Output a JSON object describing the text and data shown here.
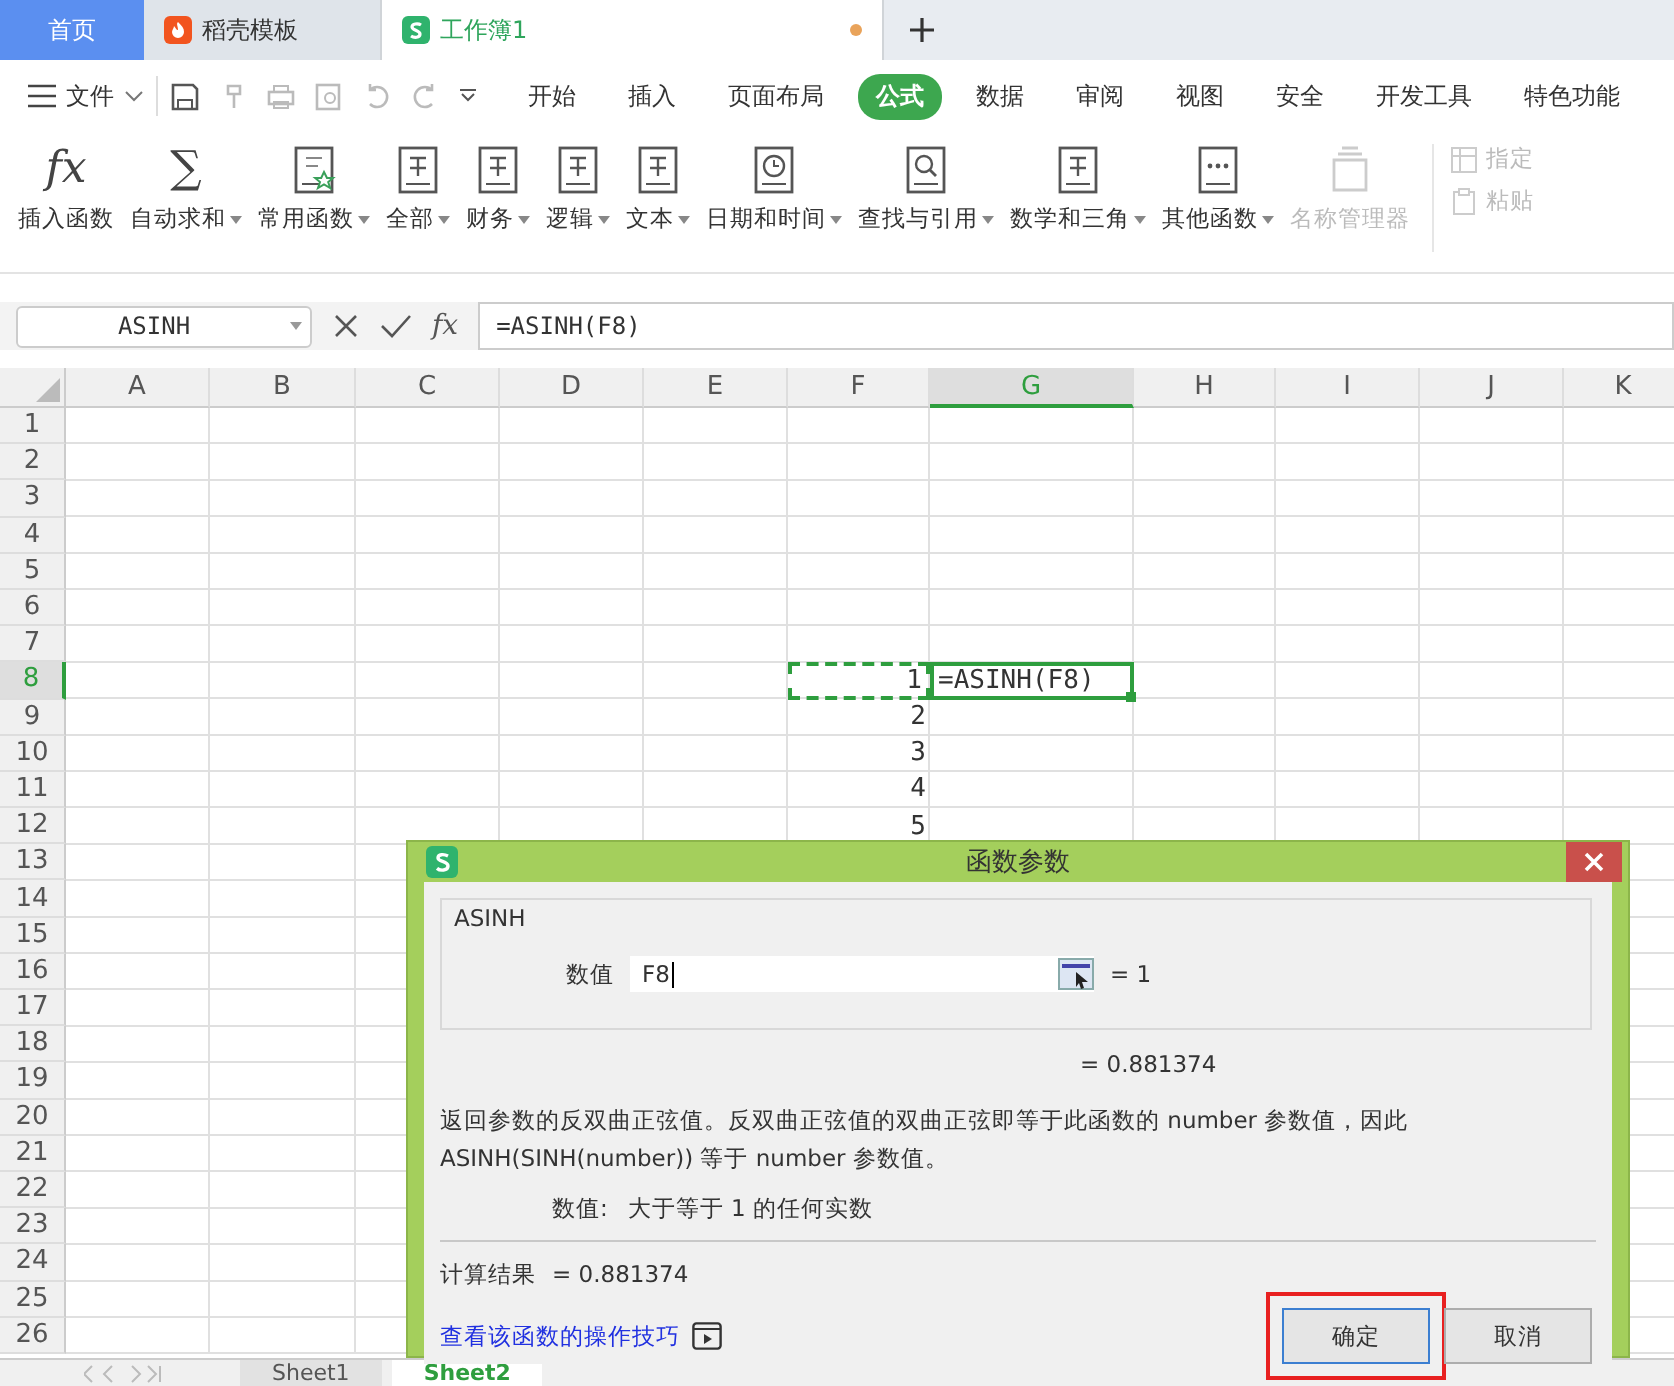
{
  "app_tabs": [
    {
      "label": "首页",
      "kind": "home",
      "selected": false
    },
    {
      "label": "稻壳模板",
      "kind": "docer",
      "selected": false
    },
    {
      "label": "工作簿1",
      "kind": "sheet",
      "selected": true,
      "unsaved": true
    }
  ],
  "menu": {
    "file": "文件",
    "tabs": [
      {
        "label": "开始",
        "selected": false
      },
      {
        "label": "插入",
        "selected": false
      },
      {
        "label": "页面布局",
        "selected": false
      },
      {
        "label": "公式",
        "selected": true
      },
      {
        "label": "数据",
        "selected": false
      },
      {
        "label": "审阅",
        "selected": false
      },
      {
        "label": "视图",
        "selected": false
      },
      {
        "label": "安全",
        "selected": false
      },
      {
        "label": "开发工具",
        "selected": false
      },
      {
        "label": "特色功能",
        "selected": false
      }
    ]
  },
  "ribbon": [
    {
      "label": "插入函数",
      "glyph": "fx",
      "kind": "glyph",
      "dropdown": false,
      "disabled": false
    },
    {
      "label": "自动求和",
      "glyph": "∑",
      "kind": "glyph",
      "dropdown": true,
      "disabled": false
    },
    {
      "label": "常用函数",
      "kind": "star-doc",
      "dropdown": true,
      "disabled": false
    },
    {
      "label": "全部",
      "kind": "lines-doc",
      "dropdown": true,
      "disabled": false
    },
    {
      "label": "财务",
      "kind": "lines-doc",
      "dropdown": true,
      "disabled": false
    },
    {
      "label": "逻辑",
      "kind": "lines-doc",
      "dropdown": true,
      "disabled": false
    },
    {
      "label": "文本",
      "kind": "lines-doc",
      "dropdown": true,
      "disabled": false
    },
    {
      "label": "日期和时间",
      "kind": "clock-doc",
      "dropdown": true,
      "disabled": false
    },
    {
      "label": "查找与引用",
      "kind": "search-doc",
      "dropdown": true,
      "disabled": false
    },
    {
      "label": "数学和三角",
      "kind": "lines-doc",
      "dropdown": true,
      "disabled": false
    },
    {
      "label": "其他函数",
      "kind": "dots-doc",
      "dropdown": true,
      "disabled": false
    },
    {
      "label": "名称管理器",
      "kind": "stack-doc",
      "dropdown": false,
      "disabled": true
    }
  ],
  "ribbon_small": [
    {
      "label": "指定",
      "kind": "table",
      "disabled": true
    },
    {
      "label": "粘贴",
      "kind": "clipboard",
      "disabled": true
    }
  ],
  "formula_bar": {
    "name_box": "ASINH",
    "fx_label": "fx",
    "formula": "=ASINH(F8)"
  },
  "columns": [
    {
      "label": "A",
      "selected": false
    },
    {
      "label": "B",
      "selected": false
    },
    {
      "label": "C",
      "selected": false
    },
    {
      "label": "D",
      "selected": false
    },
    {
      "label": "E",
      "selected": false
    },
    {
      "label": "F",
      "selected": false
    },
    {
      "label": "G",
      "selected": true
    },
    {
      "label": "H",
      "selected": false
    },
    {
      "label": "I",
      "selected": false
    },
    {
      "label": "J",
      "selected": false
    },
    {
      "label": "K",
      "selected": false
    }
  ],
  "rows": [
    {
      "label": "1",
      "selected": false
    },
    {
      "label": "2",
      "selected": false
    },
    {
      "label": "3",
      "selected": false
    },
    {
      "label": "4",
      "selected": false
    },
    {
      "label": "5",
      "selected": false
    },
    {
      "label": "6",
      "selected": false
    },
    {
      "label": "7",
      "selected": false
    },
    {
      "label": "8",
      "selected": true,
      "f": {
        "text": "1",
        "marquee": true
      },
      "g": {
        "text": "=ASINH(F8)",
        "active": true
      }
    },
    {
      "label": "9",
      "selected": false,
      "f": {
        "text": "2"
      }
    },
    {
      "label": "10",
      "selected": false,
      "f": {
        "text": "3"
      }
    },
    {
      "label": "11",
      "selected": false,
      "f": {
        "text": "4"
      }
    },
    {
      "label": "12",
      "selected": false,
      "f": {
        "text": "5"
      }
    },
    {
      "label": "13",
      "selected": false
    },
    {
      "label": "14",
      "selected": false
    },
    {
      "label": "15",
      "selected": false
    },
    {
      "label": "16",
      "selected": false
    },
    {
      "label": "17",
      "selected": false
    },
    {
      "label": "18",
      "selected": false
    },
    {
      "label": "19",
      "selected": false
    },
    {
      "label": "20",
      "selected": false
    },
    {
      "label": "21",
      "selected": false
    },
    {
      "label": "22",
      "selected": false
    },
    {
      "label": "23",
      "selected": false
    },
    {
      "label": "24",
      "selected": false
    },
    {
      "label": "25",
      "selected": false
    },
    {
      "label": "26",
      "selected": false
    }
  ],
  "sheet_tabs": [
    {
      "label": "Sheet1",
      "selected": false
    },
    {
      "label": "Sheet2",
      "selected": true
    }
  ],
  "dialog": {
    "title": "函数参数",
    "function": "ASINH",
    "arg_label": "数值",
    "arg_value": "F8",
    "arg_result": "= 1",
    "result_line": "= 0.881374",
    "description": "返回参数的反双曲正弦值。反双曲正弦值的双曲正弦即等于此函数的 number 参数值，因此 ASINH(SINH(number)) 等于 number 参数值。",
    "arg_help_label": "数值:",
    "arg_help": "大于等于 1 的任何实数",
    "calc_label": "计算结果",
    "calc_value": "= 0.881374",
    "tips_link": "查看该函数的操作技巧",
    "buttons": [
      {
        "label": "确定",
        "kind": "primary",
        "highlighted": true
      },
      {
        "label": "取消",
        "kind": "normal",
        "highlighted": false
      }
    ]
  }
}
